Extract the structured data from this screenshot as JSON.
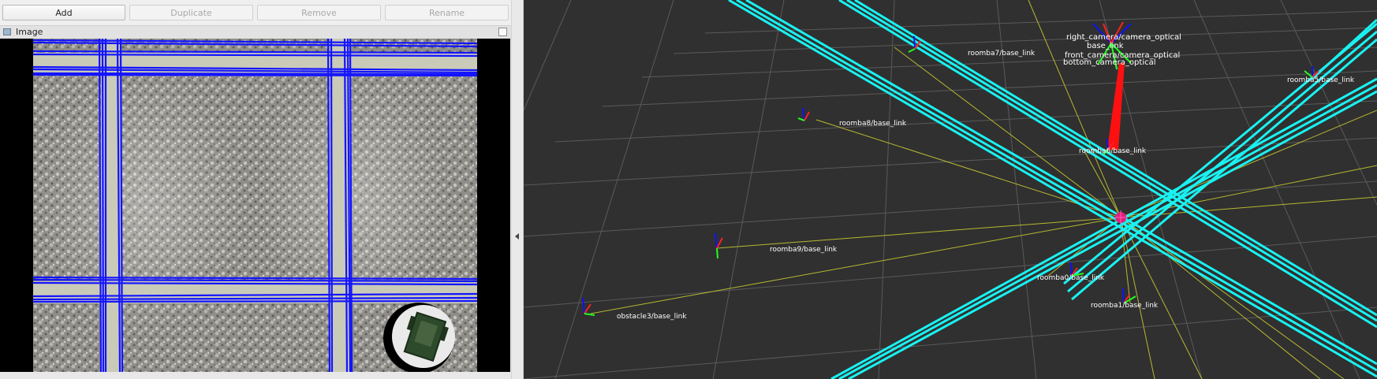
{
  "toolbar": {
    "add_label": "Add",
    "duplicate_label": "Duplicate",
    "remove_label": "Remove",
    "rename_label": "Rename"
  },
  "image_panel": {
    "title": "Image"
  },
  "rviz": {
    "frames": [
      {
        "label": "right_camera/camera_optical"
      },
      {
        "label": "base_link"
      },
      {
        "label": "front_camera/camera_optical"
      },
      {
        "label": "bottom_camera_optical"
      },
      {
        "label": "roomba7/base_link"
      },
      {
        "label": "roomba5/base_link"
      },
      {
        "label": "roomba8/base_link"
      },
      {
        "label": "roomba6/base_link"
      },
      {
        "label": "roomba9/base_link"
      },
      {
        "label": "roomba0/base_link"
      },
      {
        "label": "roomba1/base_link"
      },
      {
        "label": "obstacle3/base_link"
      }
    ]
  },
  "colors": {
    "grid_line_blue": "#1010ff",
    "marker_cyan": "#18f0f0",
    "rviz_background": "#303030",
    "grid_gray": "#5a5a5a",
    "tf_yellow": "#c8c832"
  }
}
